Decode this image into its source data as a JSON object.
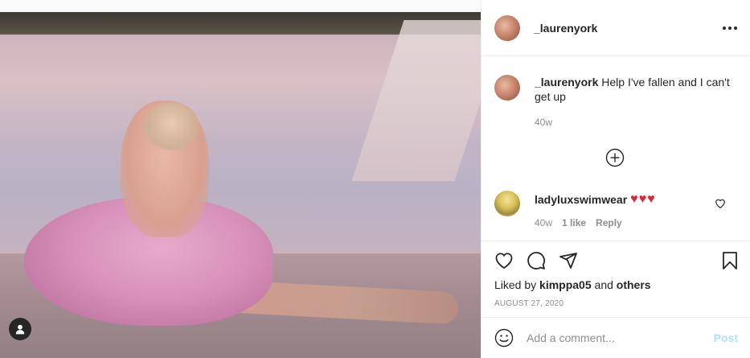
{
  "post": {
    "username": "_laurenyork",
    "image_alt": "Woman in pink tulle dress lying by a pool",
    "more_icon": "more-options-icon",
    "user_tag_icon": "user-tag-icon"
  },
  "caption": {
    "username": "_laurenyork",
    "text": "Help I've fallen and I can't get up",
    "time": "40w"
  },
  "load_more_icon": "plus-circle-icon",
  "reply": {
    "username": "ladyluxswimwear",
    "hearts": "♥♥♥",
    "time": "40w",
    "likes": "1 like",
    "reply_label": "Reply"
  },
  "actions": {
    "like_icon": "heart-icon",
    "comment_icon": "comment-icon",
    "share_icon": "share-icon",
    "save_icon": "bookmark-icon"
  },
  "liked_by": {
    "prefix": "Liked by",
    "user": "kimppa05",
    "and": "and",
    "others": "others"
  },
  "date": "AUGUST 27, 2020",
  "add_comment": {
    "placeholder": "Add a comment...",
    "post_label": "Post",
    "emoji_icon": "emoji-icon"
  },
  "colors": {
    "text": "#262626",
    "muted": "#8e8e8e",
    "border": "#efefef",
    "post_disabled": "#b2dffc",
    "heart_red": "#e0223b"
  }
}
